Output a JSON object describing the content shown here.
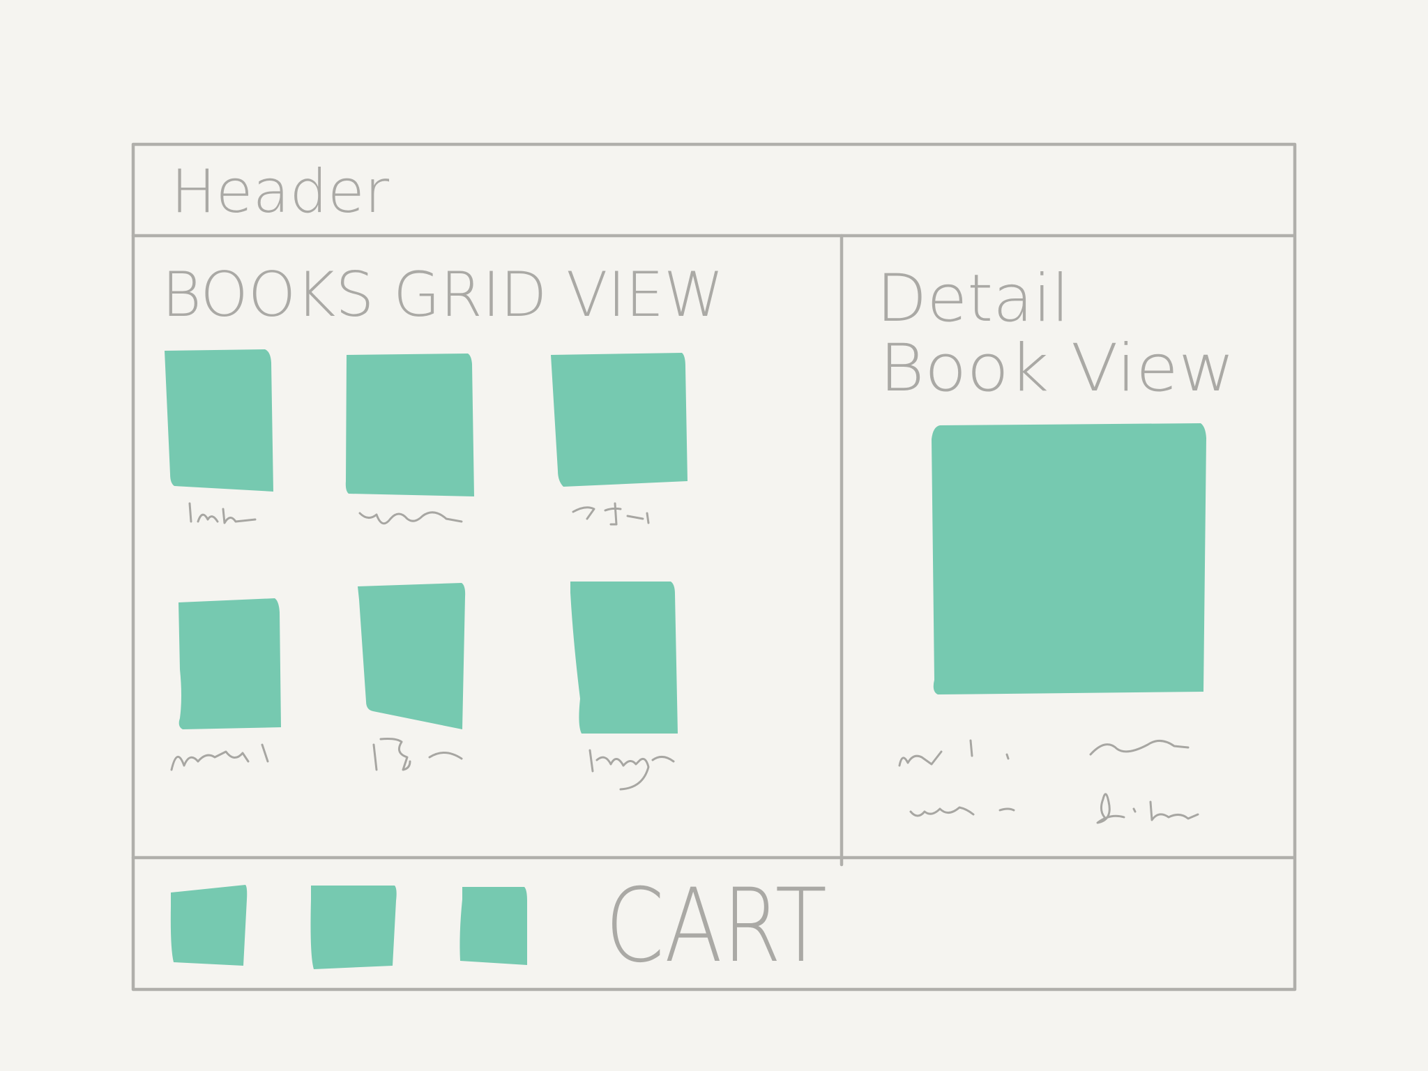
{
  "header": {
    "label": "Header"
  },
  "books_grid": {
    "title": "BOOKS GRID VIEW",
    "item_count": 6
  },
  "detail_view": {
    "title_line1": "Detail",
    "title_line2": "Book View"
  },
  "cart": {
    "label": "CART",
    "item_count": 3
  },
  "colors": {
    "background": "#f5f4f0",
    "wireframe_line": "#b0afab",
    "placeholder_fill": "#76c9b0",
    "text": "#aaa9a5"
  }
}
